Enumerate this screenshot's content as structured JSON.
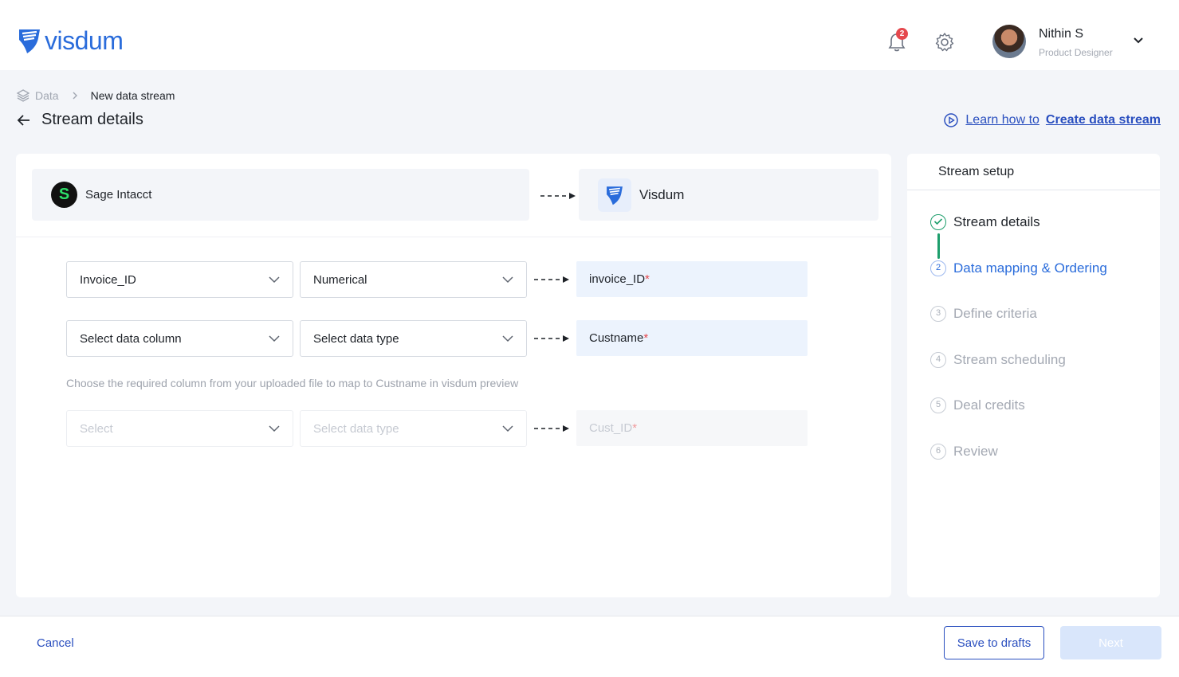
{
  "header": {
    "logo_text": "visdum",
    "notification_count": "2",
    "user_name": "Nithin S",
    "user_role": "Product Designer",
    "icons": [
      "bell-icon",
      "gear-icon",
      "chevron-down-icon"
    ]
  },
  "breadcrumb": {
    "root": "Data",
    "current": "New data stream"
  },
  "page": {
    "title": "Stream details",
    "learn_prefix": "Learn how to ",
    "learn_bold": "Create data stream"
  },
  "stream": {
    "source_name": "Sage Intacct",
    "source_logo_letter": "S",
    "destination_name": "Visdum"
  },
  "mappings": [
    {
      "column": "Invoice_ID",
      "type": "Numerical",
      "target": "invoice_ID",
      "required": "*"
    },
    {
      "column": "Select data column",
      "type": "Select data type",
      "target": "Custname",
      "required": "*"
    },
    {
      "column": "Select",
      "type": "Select data type",
      "target": "Cust_ID",
      "required": "*"
    }
  ],
  "helper_text": "Choose the required column from your uploaded file  to map to Custname in visdum preview",
  "sidebar": {
    "title": "Stream setup",
    "steps": [
      {
        "num": "1",
        "label": "Stream details",
        "status": "done"
      },
      {
        "num": "2",
        "label": "Data mapping & Ordering",
        "status": "active"
      },
      {
        "num": "3",
        "label": "Define criteria",
        "status": "pending"
      },
      {
        "num": "4",
        "label": "Stream scheduling",
        "status": "pending"
      },
      {
        "num": "5",
        "label": "Deal credits",
        "status": "pending"
      },
      {
        "num": "6",
        "label": "Review",
        "status": "pending"
      }
    ]
  },
  "footer": {
    "cancel": "Cancel",
    "save_drafts": "Save to drafts",
    "next": "Next"
  },
  "colors": {
    "brand": "#2a6cdb",
    "link": "#2a4fbf",
    "success": "#1d9e6c",
    "required": "#e5484d"
  }
}
